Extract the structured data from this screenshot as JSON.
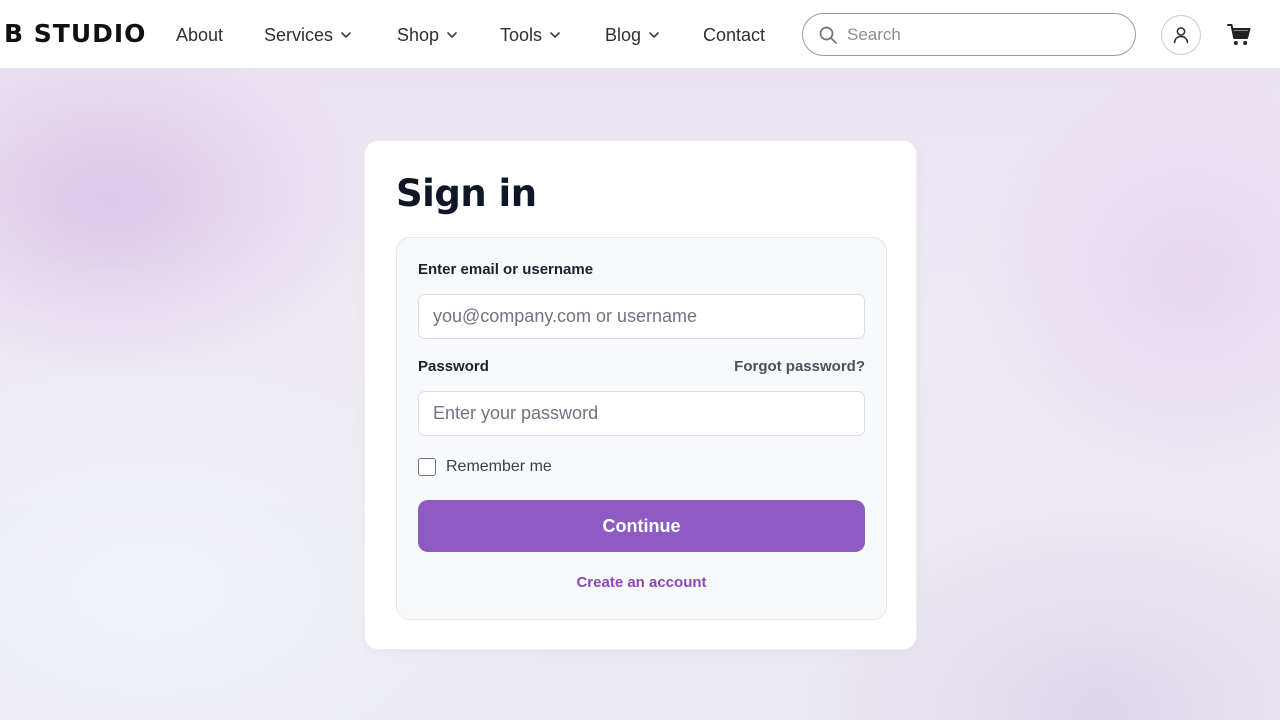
{
  "header": {
    "logo": "B STUDIO",
    "nav": [
      {
        "label": "About",
        "has_dropdown": false
      },
      {
        "label": "Services",
        "has_dropdown": true
      },
      {
        "label": "Shop",
        "has_dropdown": true
      },
      {
        "label": "Tools",
        "has_dropdown": true
      },
      {
        "label": "Blog",
        "has_dropdown": true
      },
      {
        "label": "Contact",
        "has_dropdown": false
      }
    ],
    "search": {
      "placeholder": "Search",
      "icon": "search-icon"
    },
    "account_icon": "user-icon",
    "cart_icon": "cart-icon"
  },
  "signin": {
    "title": "Sign in",
    "email_label": "Enter email or username",
    "email_placeholder": "you@company.com or username",
    "email_value": "",
    "password_label": "Password",
    "forgot_label": "Forgot password?",
    "password_placeholder": "Enter your password",
    "password_value": "",
    "remember_label": "Remember me",
    "remember_checked": false,
    "continue_label": "Continue",
    "create_label": "Create an account"
  },
  "colors": {
    "accent": "#8e5bc2",
    "link": "#8a48b8",
    "title": "#0f1628"
  }
}
